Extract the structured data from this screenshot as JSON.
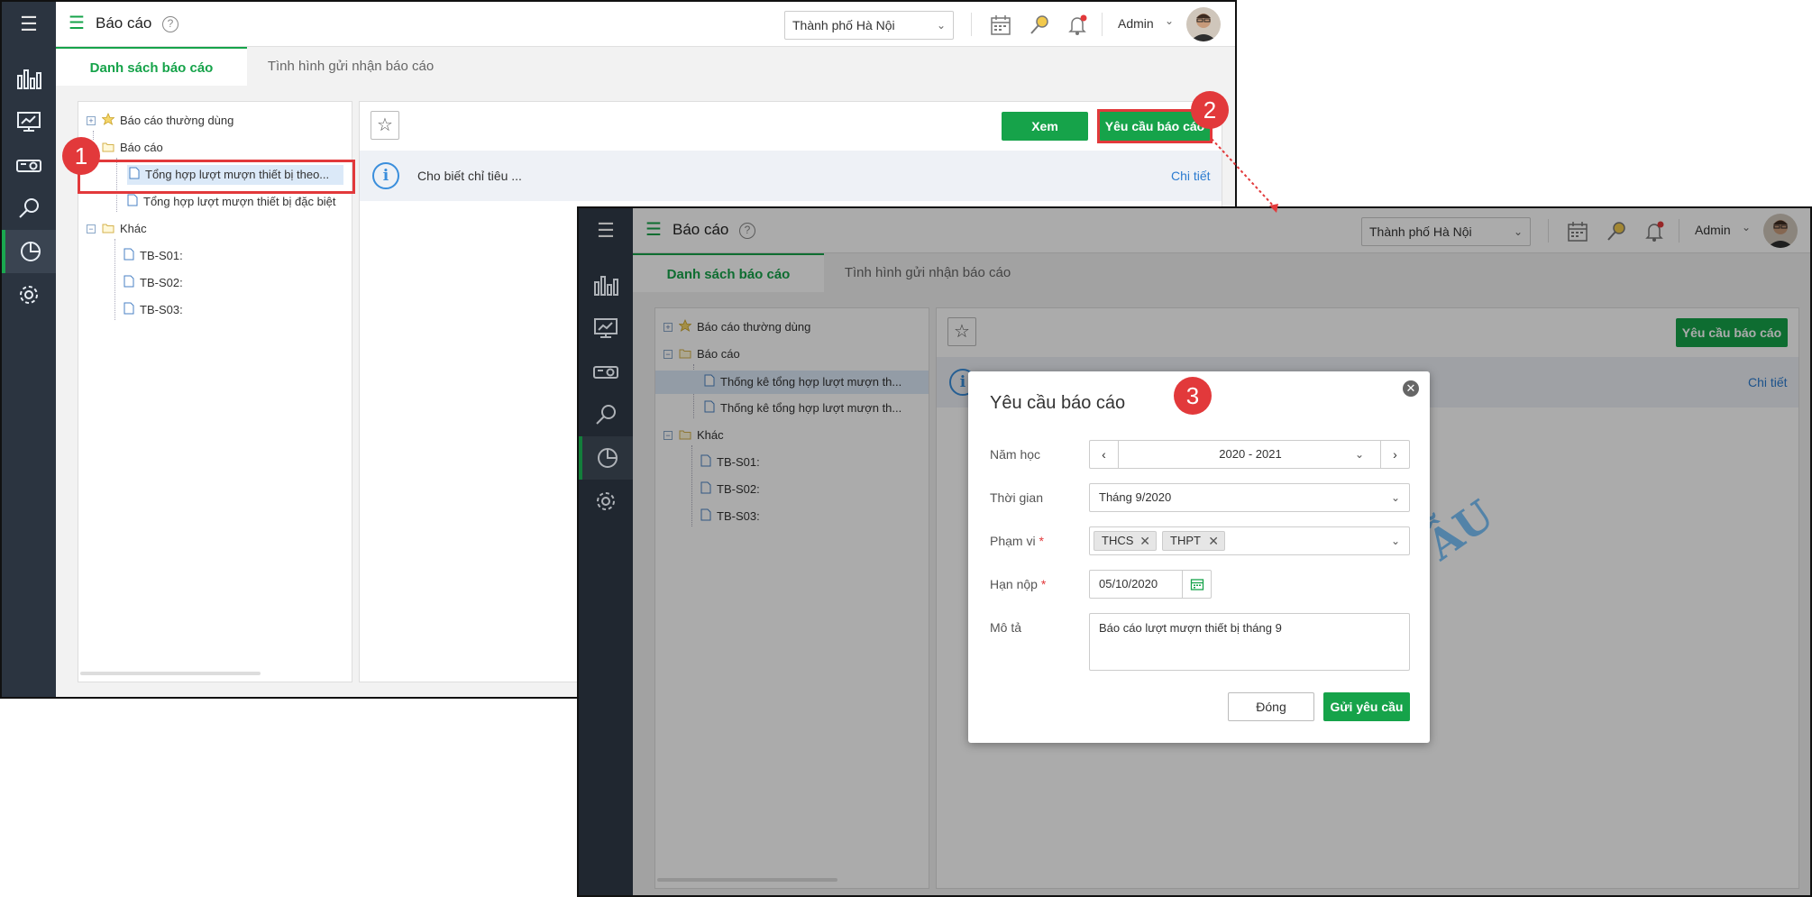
{
  "screens": [
    {
      "header": {
        "title": "Báo cáo",
        "help": "?",
        "location": "Thành phố Hà Nội",
        "user": "Admin"
      },
      "tabs": [
        "Danh sách báo cáo",
        "Tình hình gửi nhận báo cáo"
      ],
      "tree": {
        "frequent": "Báo cáo thường dùng",
        "folder": "Báo cáo",
        "items": [
          "Tổng hợp lượt mượn thiết bị theo...",
          "Tổng hợp lượt mượn thiết bị đặc biệt"
        ],
        "other": "Khác",
        "other_items": [
          "TB-S01:",
          "TB-S02:",
          "TB-S03:"
        ]
      },
      "buttons": {
        "view": "Xem",
        "request": "Yêu cầu báo cáo"
      },
      "info": {
        "text": "Cho biết chỉ tiêu ...",
        "detail": "Chi tiết"
      }
    },
    {
      "header": {
        "title": "Báo cáo",
        "help": "?",
        "location": "Thành phố Hà Nội",
        "user": "Admin"
      },
      "tabs": [
        "Danh sách báo cáo",
        "Tình hình gửi nhận báo cáo"
      ],
      "tree": {
        "frequent": "Báo cáo thường dùng",
        "folder": "Báo cáo",
        "items": [
          "Thống kê tổng hợp lượt mượn th...",
          "Thống kê tổng hợp lượt mượn th..."
        ],
        "other": "Khác",
        "other_items": [
          "TB-S01:",
          "TB-S02:",
          "TB-S03:"
        ]
      },
      "buttons": {
        "request": "Yêu cầu báo cáo"
      },
      "info": {
        "detail": "Chi tiết"
      },
      "watermark": "ẪU"
    }
  ],
  "modal": {
    "title": "Yêu cầu báo cáo",
    "close": "✕",
    "fields": {
      "school_year": {
        "label": "Năm học",
        "value": "2020 - 2021"
      },
      "period": {
        "label": "Thời gian",
        "value": "Tháng 9/2020"
      },
      "scope": {
        "label": "Phạm vi",
        "required": "*",
        "tags": [
          "THCS",
          "THPT"
        ]
      },
      "deadline": {
        "label": "Hạn nộp",
        "required": "*",
        "value": "05/10/2020"
      },
      "description": {
        "label": "Mô tả",
        "value": "Báo cáo lượt mượn thiết bị tháng 9"
      }
    },
    "buttons": {
      "close": "Đóng",
      "submit": "Gửi yêu cầu"
    }
  },
  "callouts": [
    "1",
    "2",
    "3"
  ],
  "colors": {
    "accent": "#16a34a",
    "sidebar": "#2b3440",
    "highlight": "#e2393b",
    "link": "#2b7bd0"
  },
  "icons": [
    "menu-icon",
    "bar-chart-icon",
    "monitor-icon",
    "projector-icon",
    "search-icon",
    "pie-chart-icon",
    "gear-icon",
    "calendar-icon",
    "key-search-icon",
    "bell-icon"
  ]
}
